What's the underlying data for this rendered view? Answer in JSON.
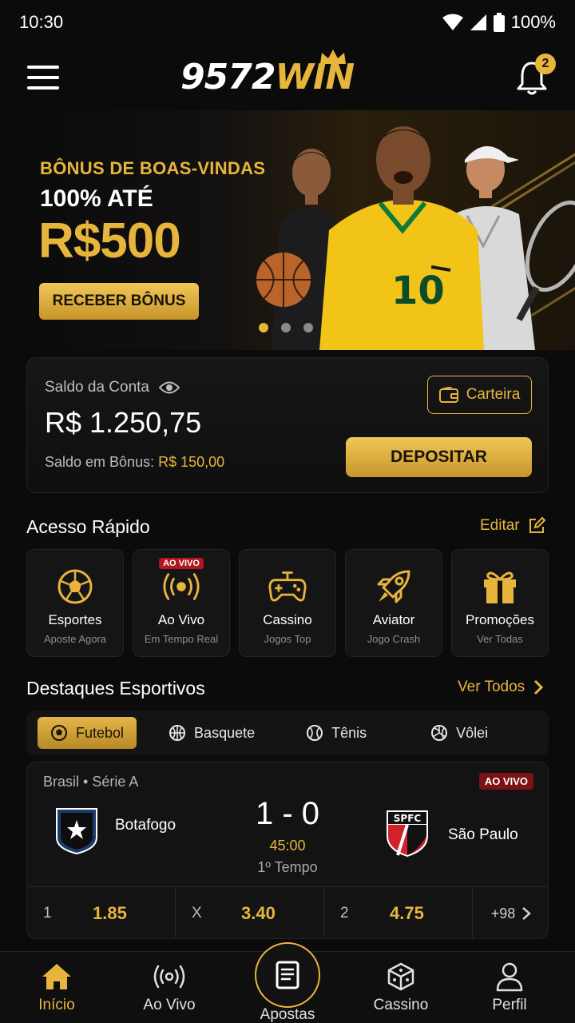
{
  "status_bar": {
    "time": "10:30",
    "battery": "100%"
  },
  "header": {
    "logo_number": "9572",
    "logo_suffix": "WIN",
    "notification_count": "2"
  },
  "hero": {
    "eyebrow": "BÔNUS DE BOAS-VINDAS",
    "line": "100% ATÉ",
    "amount": "R$500",
    "cta": "RECEBER BÔNUS",
    "jersey_number": "10",
    "slides_total": 3,
    "slide_active": 1
  },
  "balance": {
    "label": "Saldo da Conta",
    "value": "R$ 1.250,75",
    "bonus_label": "Saldo em Bônus:",
    "bonus_value": "R$ 150,00",
    "wallet_button": "Carteira",
    "deposit_button": "DEPOSITAR"
  },
  "quick_access": {
    "title": "Acesso Rápido",
    "edit_label": "Editar",
    "items": [
      {
        "label": "Esportes",
        "sub": "Aposte Agora",
        "icon": "soccer-ball-icon"
      },
      {
        "label": "Ao Vivo",
        "sub": "Em Tempo Real",
        "icon": "broadcast-icon",
        "tag": "AO VIVO"
      },
      {
        "label": "Cassino",
        "sub": "Jogos Top",
        "icon": "gamepad-icon"
      },
      {
        "label": "Aviator",
        "sub": "Jogo Crash",
        "icon": "rocket-icon"
      },
      {
        "label": "Promoções",
        "sub": "Ver Todas",
        "icon": "gift-icon"
      }
    ]
  },
  "highlights": {
    "title": "Destaques Esportivos",
    "see_all": "Ver Todos",
    "tabs": [
      {
        "label": "Futebol",
        "icon": "soccer-ball-icon",
        "active": true
      },
      {
        "label": "Basquete",
        "icon": "basketball-icon"
      },
      {
        "label": "Tênis",
        "icon": "tennis-ball-icon"
      },
      {
        "label": "Vôlei",
        "icon": "volleyball-icon"
      }
    ]
  },
  "match": {
    "league": "Brasil • Série A",
    "live_badge": "AO VIVO",
    "home_team": "Botafogo",
    "away_team": "São Paulo",
    "away_crest_text": "SPFC",
    "score": "1 - 0",
    "clock": "45:00",
    "period": "1º Tempo",
    "odds": [
      {
        "label": "1",
        "value": "1.85"
      },
      {
        "label": "X",
        "value": "3.40"
      },
      {
        "label": "2",
        "value": "4.75"
      }
    ],
    "more_markets": "+98"
  },
  "bottom_nav": {
    "items": [
      {
        "label": "Início",
        "icon": "home-icon",
        "active": true
      },
      {
        "label": "Ao Vivo",
        "icon": "broadcast-icon"
      },
      {
        "label": "Apostas",
        "icon": "betslip-icon"
      },
      {
        "label": "Cassino",
        "icon": "dice-icon"
      },
      {
        "label": "Perfil",
        "icon": "user-icon"
      }
    ]
  },
  "colors": {
    "accent": "#e8b53c",
    "background": "#0b0b0c",
    "live": "#b2161e"
  }
}
